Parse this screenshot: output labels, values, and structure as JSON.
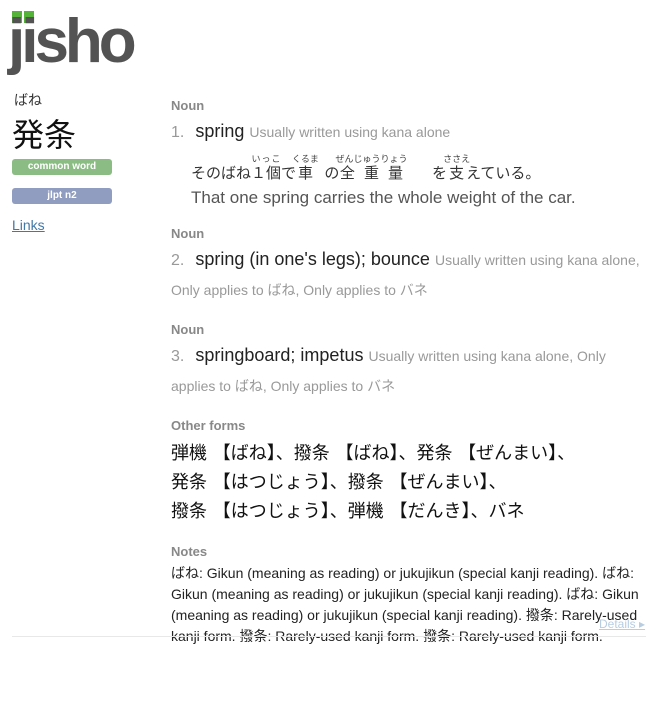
{
  "logo": {
    "text": "jisho"
  },
  "entry": {
    "reading": "ばね",
    "kanji": "発条",
    "tags": {
      "common": "common word",
      "jlpt": "jlpt n2"
    },
    "links_label": "Links"
  },
  "meanings": [
    {
      "pos": "Noun",
      "num": "1.",
      "text": "spring",
      "info": "Usually written using kana alone",
      "sentence": {
        "jp_parts": [
          "そのばね",
          "１個",
          "で",
          "車",
          "の",
          "全",
          "重量",
          "を",
          "支",
          "えている。"
        ],
        "furigana": {
          "ikko": "いっこ",
          "kuruma": "くるま",
          "zenjuuryou": "ぜんじゅうりょう",
          "sasae": "ささえ"
        },
        "en": "That one spring carries the whole weight of the car."
      }
    },
    {
      "pos": "Noun",
      "num": "2.",
      "text": "spring (in one's legs); bounce",
      "info": "Usually written using kana alone, Only applies to ばね, Only applies to バネ"
    },
    {
      "pos": "Noun",
      "num": "3.",
      "text": "springboard; impetus",
      "info": "Usually written using kana alone, Only applies to ばね, Only applies to バネ"
    }
  ],
  "other_forms": {
    "label": "Other forms",
    "line1": "弾機 【ばね】、撥条 【ばね】、発条 【ぜんまい】、",
    "line2": "発条 【はつじょう】、撥条 【ぜんまい】、",
    "line3": "撥条 【はつじょう】、弾機 【だんき】、バネ"
  },
  "notes": {
    "label": "Notes",
    "text": "ばね: Gikun (meaning as reading) or jukujikun (special kanji reading). ばね: Gikun (meaning as reading) or jukujikun (special kanji reading). ばね: Gikun (meaning as reading) or jukujikun (special kanji reading). 撥条: Rarely-used kanji form. 撥条: Rarely-used kanji form. 撥条: Rarely-used kanji form."
  },
  "details_label": "Details ▸",
  "colors": {
    "common": "#8abc83",
    "jlpt": "#909dc0",
    "link": "#4178a8",
    "logo_green": "#56b33a"
  }
}
